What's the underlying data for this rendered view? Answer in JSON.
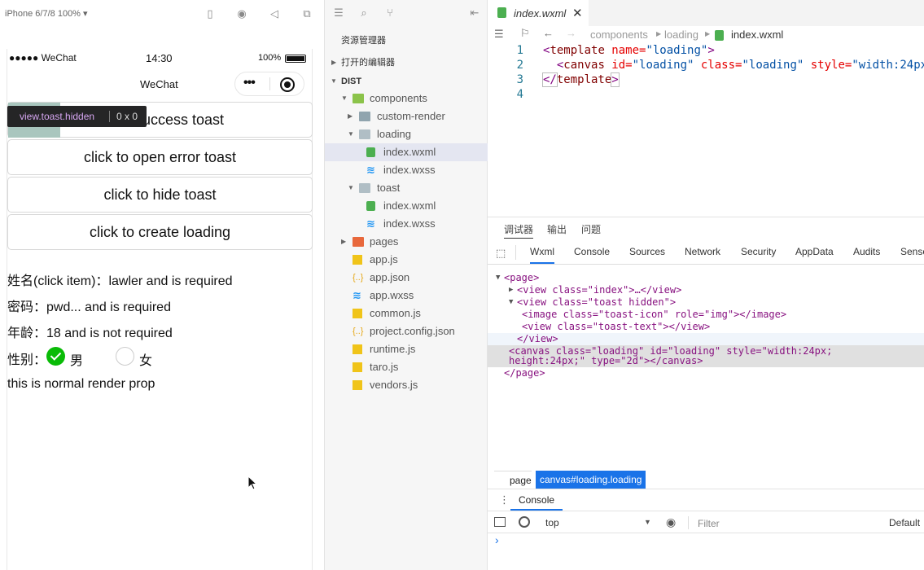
{
  "simulator": {
    "device_label": "iPhone 6/7/8 100% ▾",
    "status": {
      "signal": "●●●●● WeChat",
      "time": "14:30",
      "battery": "100%"
    },
    "nav_title": "WeChat",
    "tooltip": {
      "selector": "view.toast.hidden",
      "size": "0 x 0"
    },
    "buttons": [
      "click to open success toast",
      "click to open error toast",
      "click to hide toast",
      "click to create loading"
    ],
    "visible_first_button_text": "n success toast",
    "fields": [
      "姓名(click item)：lawler and is required",
      "密码：pwd... and is required",
      "年龄：18 and is not required"
    ],
    "gender_label": "性别：",
    "gender_options": [
      {
        "label": "男",
        "checked": true
      },
      {
        "label": "女",
        "checked": false
      }
    ],
    "render_text": "this is normal render prop",
    "accent_color": "#09bb07"
  },
  "explorer": {
    "title": "资源管理器",
    "open_editors": "打开的编辑器",
    "root": "DIST",
    "items": [
      {
        "label": "components",
        "type": "folder-open",
        "depth": 1
      },
      {
        "label": "custom-render",
        "type": "folder",
        "depth": 2
      },
      {
        "label": "loading",
        "type": "folder-open",
        "depth": 2
      },
      {
        "label": "index.wxml",
        "type": "wxml",
        "depth": 3,
        "selected": true
      },
      {
        "label": "index.wxss",
        "type": "wxss",
        "depth": 3
      },
      {
        "label": "toast",
        "type": "folder-open",
        "depth": 2
      },
      {
        "label": "index.wxml",
        "type": "wxml",
        "depth": 3
      },
      {
        "label": "index.wxss",
        "type": "wxss",
        "depth": 3
      },
      {
        "label": "pages",
        "type": "folder-pages",
        "depth": 1
      },
      {
        "label": "app.js",
        "type": "js",
        "depth": 1
      },
      {
        "label": "app.json",
        "type": "json",
        "depth": 1
      },
      {
        "label": "app.wxss",
        "type": "wxss",
        "depth": 1
      },
      {
        "label": "common.js",
        "type": "js",
        "depth": 1
      },
      {
        "label": "project.config.json",
        "type": "json",
        "depth": 1
      },
      {
        "label": "runtime.js",
        "type": "js",
        "depth": 1
      },
      {
        "label": "taro.js",
        "type": "js",
        "depth": 1
      },
      {
        "label": "vendors.js",
        "type": "js",
        "depth": 1
      }
    ]
  },
  "editor": {
    "tab_label": "index.wxml",
    "breadcrumb": [
      "components",
      "loading",
      "index.wxml"
    ],
    "line_numbers": [
      "1",
      "2",
      "3",
      "4"
    ],
    "code": {
      "l1_open": "<",
      "l1_tag": "template",
      "l1_attr": " name=",
      "l1_val": "\"loading\"",
      "l1_close": ">",
      "l2_open": "  <",
      "l2_tag": "canvas",
      "l2_a1": " id=",
      "l2_v1": "\"loading\"",
      "l2_a2": " class=",
      "l2_v2": "\"loading\"",
      "l2_a3": " style=",
      "l2_v3": "\"width:24px",
      "l3_open": "</",
      "l3_tag": "template",
      "l3_close": ">"
    }
  },
  "devtools": {
    "top_tabs": [
      "调试器",
      "输出",
      "问题"
    ],
    "panel_tabs": [
      "Wxml",
      "Console",
      "Sources",
      "Network",
      "Security",
      "AppData",
      "Audits",
      "Sensor"
    ],
    "xml": {
      "page_open": "<page>",
      "index_view": "<view class=\"index\">…</view>",
      "toast_view": "<view class=\"toast hidden\">",
      "image_line": "<image class=\"toast-icon\" role=\"img\"></image>",
      "text_line": "<view class=\"toast-text\"></view>",
      "close_view": "</view>",
      "canvas_l1": "<canvas class=\"loading\" id=\"loading\" style=\"width:24px;",
      "canvas_l2": "height:24px;\" type=\"2d\"></canvas>",
      "page_close": "</page>"
    },
    "breadcrumb": [
      "page",
      "canvas#loading.loading"
    ],
    "console_tab": "Console",
    "context": "top",
    "filter_placeholder": "Filter",
    "levels": "Default",
    "prompt": "›"
  }
}
